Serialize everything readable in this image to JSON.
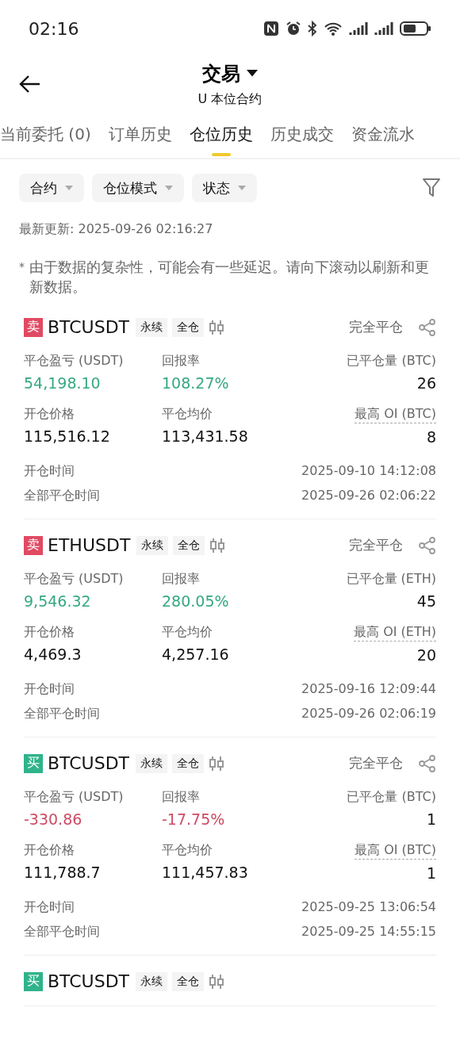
{
  "status_bar": {
    "time": "02:16"
  },
  "header": {
    "title": "交易",
    "subtitle": "U 本位合约"
  },
  "tabs": [
    {
      "label": "当前委托 (0)",
      "selected": false
    },
    {
      "label": "订单历史",
      "selected": false
    },
    {
      "label": "仓位历史",
      "selected": true
    },
    {
      "label": "历史成交",
      "selected": false
    },
    {
      "label": "资金流水",
      "selected": false
    }
  ],
  "filters": [
    "合约",
    "仓位模式",
    "状态"
  ],
  "last_update": "最新更新: 2025-09-26 02:16:27",
  "note_mark": "*",
  "note": "由于数据的复杂性，可能会有一些延迟。请向下滚动以刷新和更新数据。",
  "positions": [
    {
      "side": {
        "kind": "sell",
        "label": "卖"
      },
      "symbol": "BTCUSDT",
      "tags": [
        "永续",
        "全仓"
      ],
      "status": "完全平仓",
      "profit": true,
      "pnl_label": "平仓盈亏 (USDT)",
      "pnl": "54,198.10",
      "roi_label": "回报率",
      "roi": "108.27%",
      "qty_label": "已平仓量 (BTC)",
      "qty": "26",
      "open_price_label": "开仓价格",
      "open_price": "115,516.12",
      "close_price_label": "平仓均价",
      "close_price": "113,431.58",
      "max_oi_label": "最高 OI (BTC)",
      "max_oi": "8",
      "open_time_label": "开仓时间",
      "open_time": "2025-09-10 14:12:08",
      "close_time_label": "全部平仓时间",
      "close_time": "2025-09-26 02:06:22"
    },
    {
      "side": {
        "kind": "sell",
        "label": "卖"
      },
      "symbol": "ETHUSDT",
      "tags": [
        "永续",
        "全仓"
      ],
      "status": "完全平仓",
      "profit": true,
      "pnl_label": "平仓盈亏 (USDT)",
      "pnl": "9,546.32",
      "roi_label": "回报率",
      "roi": "280.05%",
      "qty_label": "已平仓量 (ETH)",
      "qty": "45",
      "open_price_label": "开仓价格",
      "open_price": "4,469.3",
      "close_price_label": "平仓均价",
      "close_price": "4,257.16",
      "max_oi_label": "最高 OI (ETH)",
      "max_oi": "20",
      "open_time_label": "开仓时间",
      "open_time": "2025-09-16 12:09:44",
      "close_time_label": "全部平仓时间",
      "close_time": "2025-09-26 02:06:19"
    },
    {
      "side": {
        "kind": "buy",
        "label": "买"
      },
      "symbol": "BTCUSDT",
      "tags": [
        "永续",
        "全仓"
      ],
      "status": "完全平仓",
      "profit": false,
      "pnl_label": "平仓盈亏 (USDT)",
      "pnl": "-330.86",
      "roi_label": "回报率",
      "roi": "-17.75%",
      "qty_label": "已平仓量 (BTC)",
      "qty": "1",
      "open_price_label": "开仓价格",
      "open_price": "111,788.7",
      "close_price_label": "平仓均价",
      "close_price": "111,457.83",
      "max_oi_label": "最高 OI (BTC)",
      "max_oi": "1",
      "open_time_label": "开仓时间",
      "open_time": "2025-09-25 13:06:54",
      "close_time_label": "全部平仓时间",
      "close_time": "2025-09-25 14:55:15"
    },
    {
      "side": {
        "kind": "buy",
        "label": "买"
      },
      "symbol": "BTCUSDT",
      "tags": [
        "永续",
        "全仓"
      ]
    }
  ]
}
